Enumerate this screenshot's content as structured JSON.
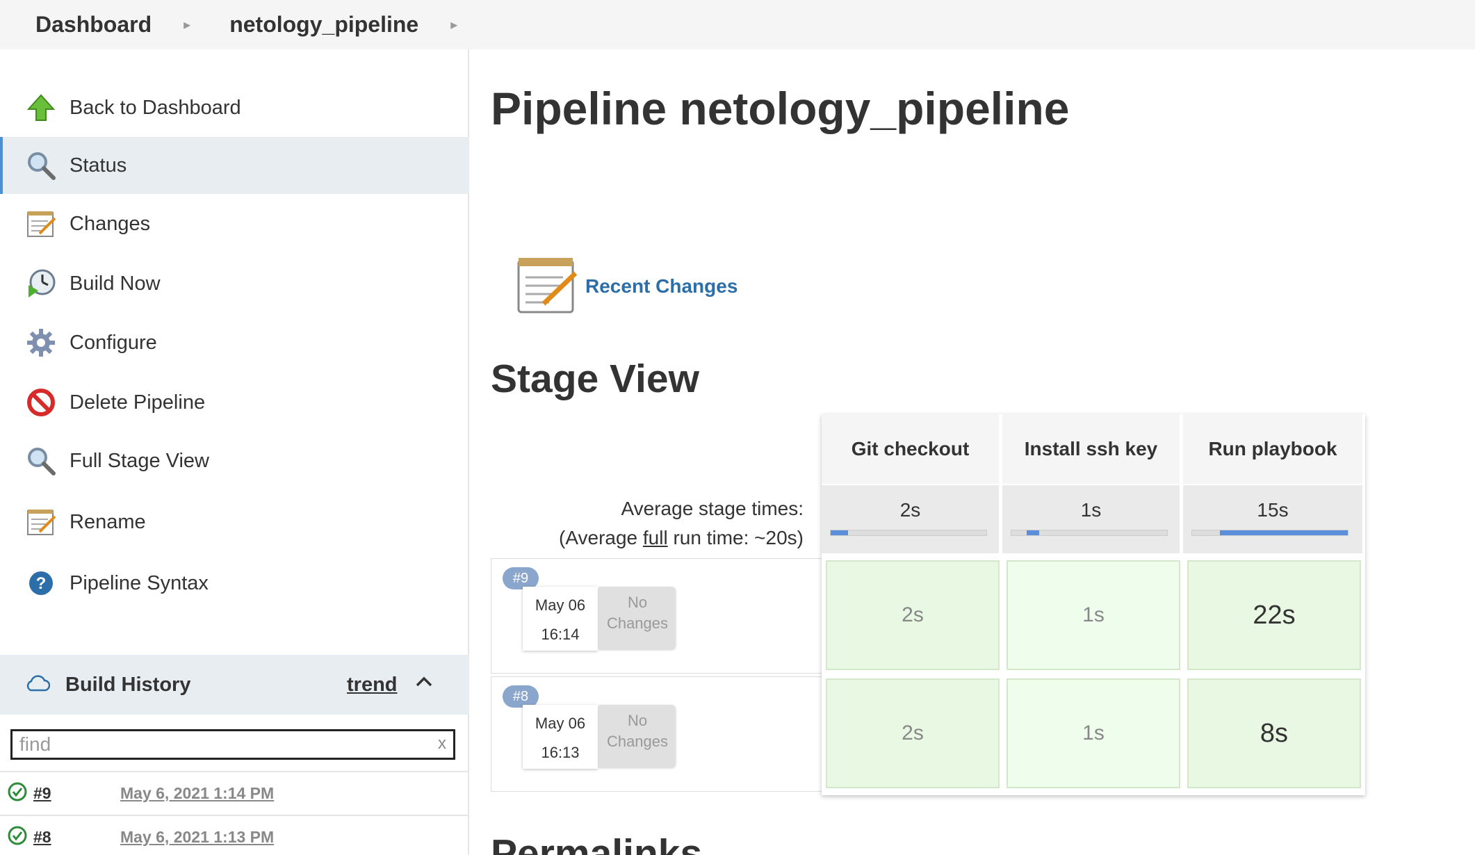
{
  "breadcrumb": {
    "home": "Dashboard",
    "current": "netology_pipeline"
  },
  "sidebar": {
    "items": [
      {
        "label": "Back to Dashboard",
        "icon": "up-arrow-icon"
      },
      {
        "label": "Status",
        "icon": "magnifier-icon",
        "active": true
      },
      {
        "label": "Changes",
        "icon": "notepad-icon"
      },
      {
        "label": "Build Now",
        "icon": "clock-play-icon"
      },
      {
        "label": "Configure",
        "icon": "gear-icon"
      },
      {
        "label": "Delete Pipeline",
        "icon": "no-entry-icon"
      },
      {
        "label": "Full Stage View",
        "icon": "magnifier-icon"
      },
      {
        "label": "Rename",
        "icon": "notepad-icon"
      },
      {
        "label": "Pipeline Syntax",
        "icon": "help-icon"
      }
    ]
  },
  "build_history": {
    "title": "Build History",
    "trend": "trend",
    "find_value": "find",
    "clear": "x",
    "builds": [
      {
        "number": "#9",
        "date": "May 6, 2021 1:14 PM"
      },
      {
        "number": "#8",
        "date": "May 6, 2021 1:13 PM"
      }
    ]
  },
  "main": {
    "title": "Pipeline netology_pipeline",
    "recent_changes": "Recent Changes",
    "stage_view_title": "Stage View",
    "permalinks_title": "Permalinks"
  },
  "stage_view": {
    "avg_label_1": "Average stage times:",
    "avg_label_2_prefix": "(Average ",
    "avg_label_2_link": "full",
    "avg_label_2_suffix": " run time: ~20s)",
    "stages": [
      {
        "name": "Git checkout",
        "avg": "2s",
        "bar_start": 0.0,
        "bar_width": 0.11
      },
      {
        "name": "Install ssh key",
        "avg": "1s",
        "bar_start": 0.1,
        "bar_width": 0.08
      },
      {
        "name": "Run playbook",
        "avg": "15s",
        "bar_start": 0.18,
        "bar_width": 0.82
      }
    ],
    "runs": [
      {
        "badge": "#9",
        "date": "May 06",
        "time": "16:14",
        "changes_1": "No",
        "changes_2": "Changes",
        "durations": [
          "2s",
          "1s",
          "22s"
        ]
      },
      {
        "badge": "#8",
        "date": "May 06",
        "time": "16:13",
        "changes_1": "No",
        "changes_2": "Changes",
        "durations": [
          "2s",
          "1s",
          "8s"
        ]
      }
    ]
  },
  "colors": {
    "accent": "#4a90d9",
    "link": "#2b6ea8",
    "success_green": "#e8f8e2",
    "bar_blue": "#5b8fd9"
  }
}
